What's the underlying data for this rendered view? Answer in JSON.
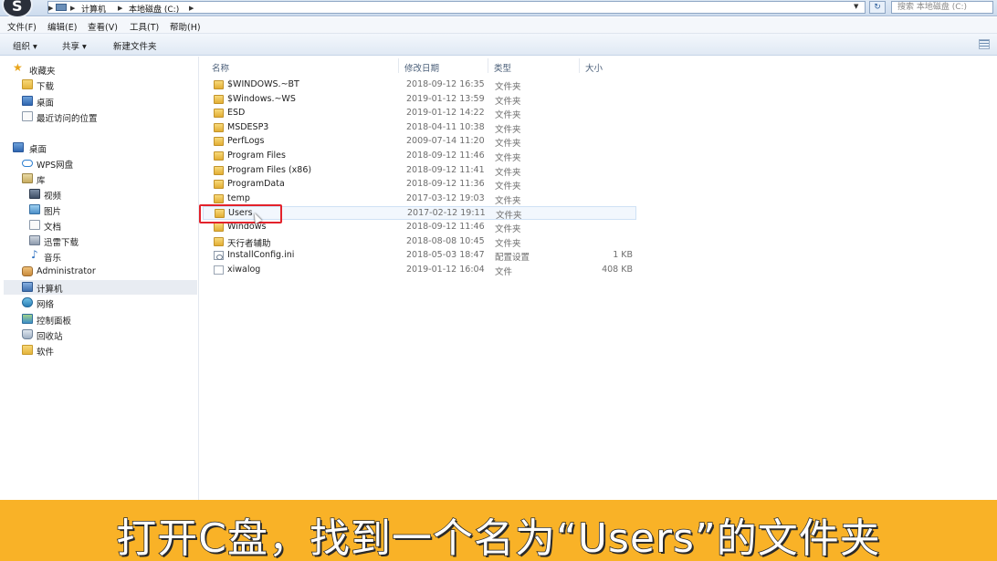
{
  "address_bar": {
    "breadcrumbs": [
      "计算机",
      "本地磁盘 (C:)"
    ],
    "search_placeholder": "搜索 本地磁盘 (C:)",
    "logo_text": "S"
  },
  "menu": {
    "items": [
      "文件(F)",
      "编辑(E)",
      "查看(V)",
      "工具(T)",
      "帮助(H)"
    ]
  },
  "toolbar": {
    "organize": "组织 ▾",
    "share": "共享 ▾",
    "new_folder": "新建文件夹"
  },
  "nav": {
    "favorites": "收藏夹",
    "downloads": "下载",
    "desktop_fav": "桌面",
    "recent": "最近访问的位置",
    "desktop": "桌面",
    "wps": "WPS网盘",
    "library": "库",
    "videos": "视频",
    "pictures": "图片",
    "documents": "文档",
    "thunder": "迅雷下载",
    "music": "音乐",
    "admin": "Administrator",
    "computer": "计算机",
    "network": "网络",
    "control_panel": "控制面板",
    "recycle_bin": "回收站",
    "software": "软件"
  },
  "columns": {
    "name": "名称",
    "modified": "修改日期",
    "type": "类型",
    "size": "大小"
  },
  "files": [
    {
      "name": "$WINDOWS.~BT",
      "date": "2018-09-12 16:35",
      "type": "文件夹",
      "size": ""
    },
    {
      "name": "$Windows.~WS",
      "date": "2019-01-12 13:59",
      "type": "文件夹",
      "size": ""
    },
    {
      "name": "ESD",
      "date": "2019-01-12 14:22",
      "type": "文件夹",
      "size": ""
    },
    {
      "name": "MSDESP3",
      "date": "2018-04-11 10:38",
      "type": "文件夹",
      "size": ""
    },
    {
      "name": "PerfLogs",
      "date": "2009-07-14 11:20",
      "type": "文件夹",
      "size": ""
    },
    {
      "name": "Program Files",
      "date": "2018-09-12 11:46",
      "type": "文件夹",
      "size": ""
    },
    {
      "name": "Program Files (x86)",
      "date": "2018-09-12 11:41",
      "type": "文件夹",
      "size": ""
    },
    {
      "name": "ProgramData",
      "date": "2018-09-12 11:36",
      "type": "文件夹",
      "size": ""
    },
    {
      "name": "temp",
      "date": "2017-03-12 19:03",
      "type": "文件夹",
      "size": ""
    },
    {
      "name": "Users",
      "date": "2017-02-12 19:11",
      "type": "文件夹",
      "size": ""
    },
    {
      "name": "Windows",
      "date": "2018-09-12 11:46",
      "type": "文件夹",
      "size": ""
    },
    {
      "name": "天行者辅助",
      "date": "2018-08-08 10:45",
      "type": "文件夹",
      "size": ""
    },
    {
      "name": "InstallConfig.ini",
      "date": "2018-05-03 18:47",
      "type": "配置设置",
      "size": "1 KB"
    },
    {
      "name": "xiwalog",
      "date": "2019-01-12 16:04",
      "type": "文件",
      "size": "408 KB"
    }
  ],
  "caption": "打开C盘，找到一个名为“Users”的文件夹",
  "colors": {
    "caption_bg": "#f9b227",
    "highlight_box": "#e3222b",
    "toolbar_bg": "#e0e9f4"
  }
}
